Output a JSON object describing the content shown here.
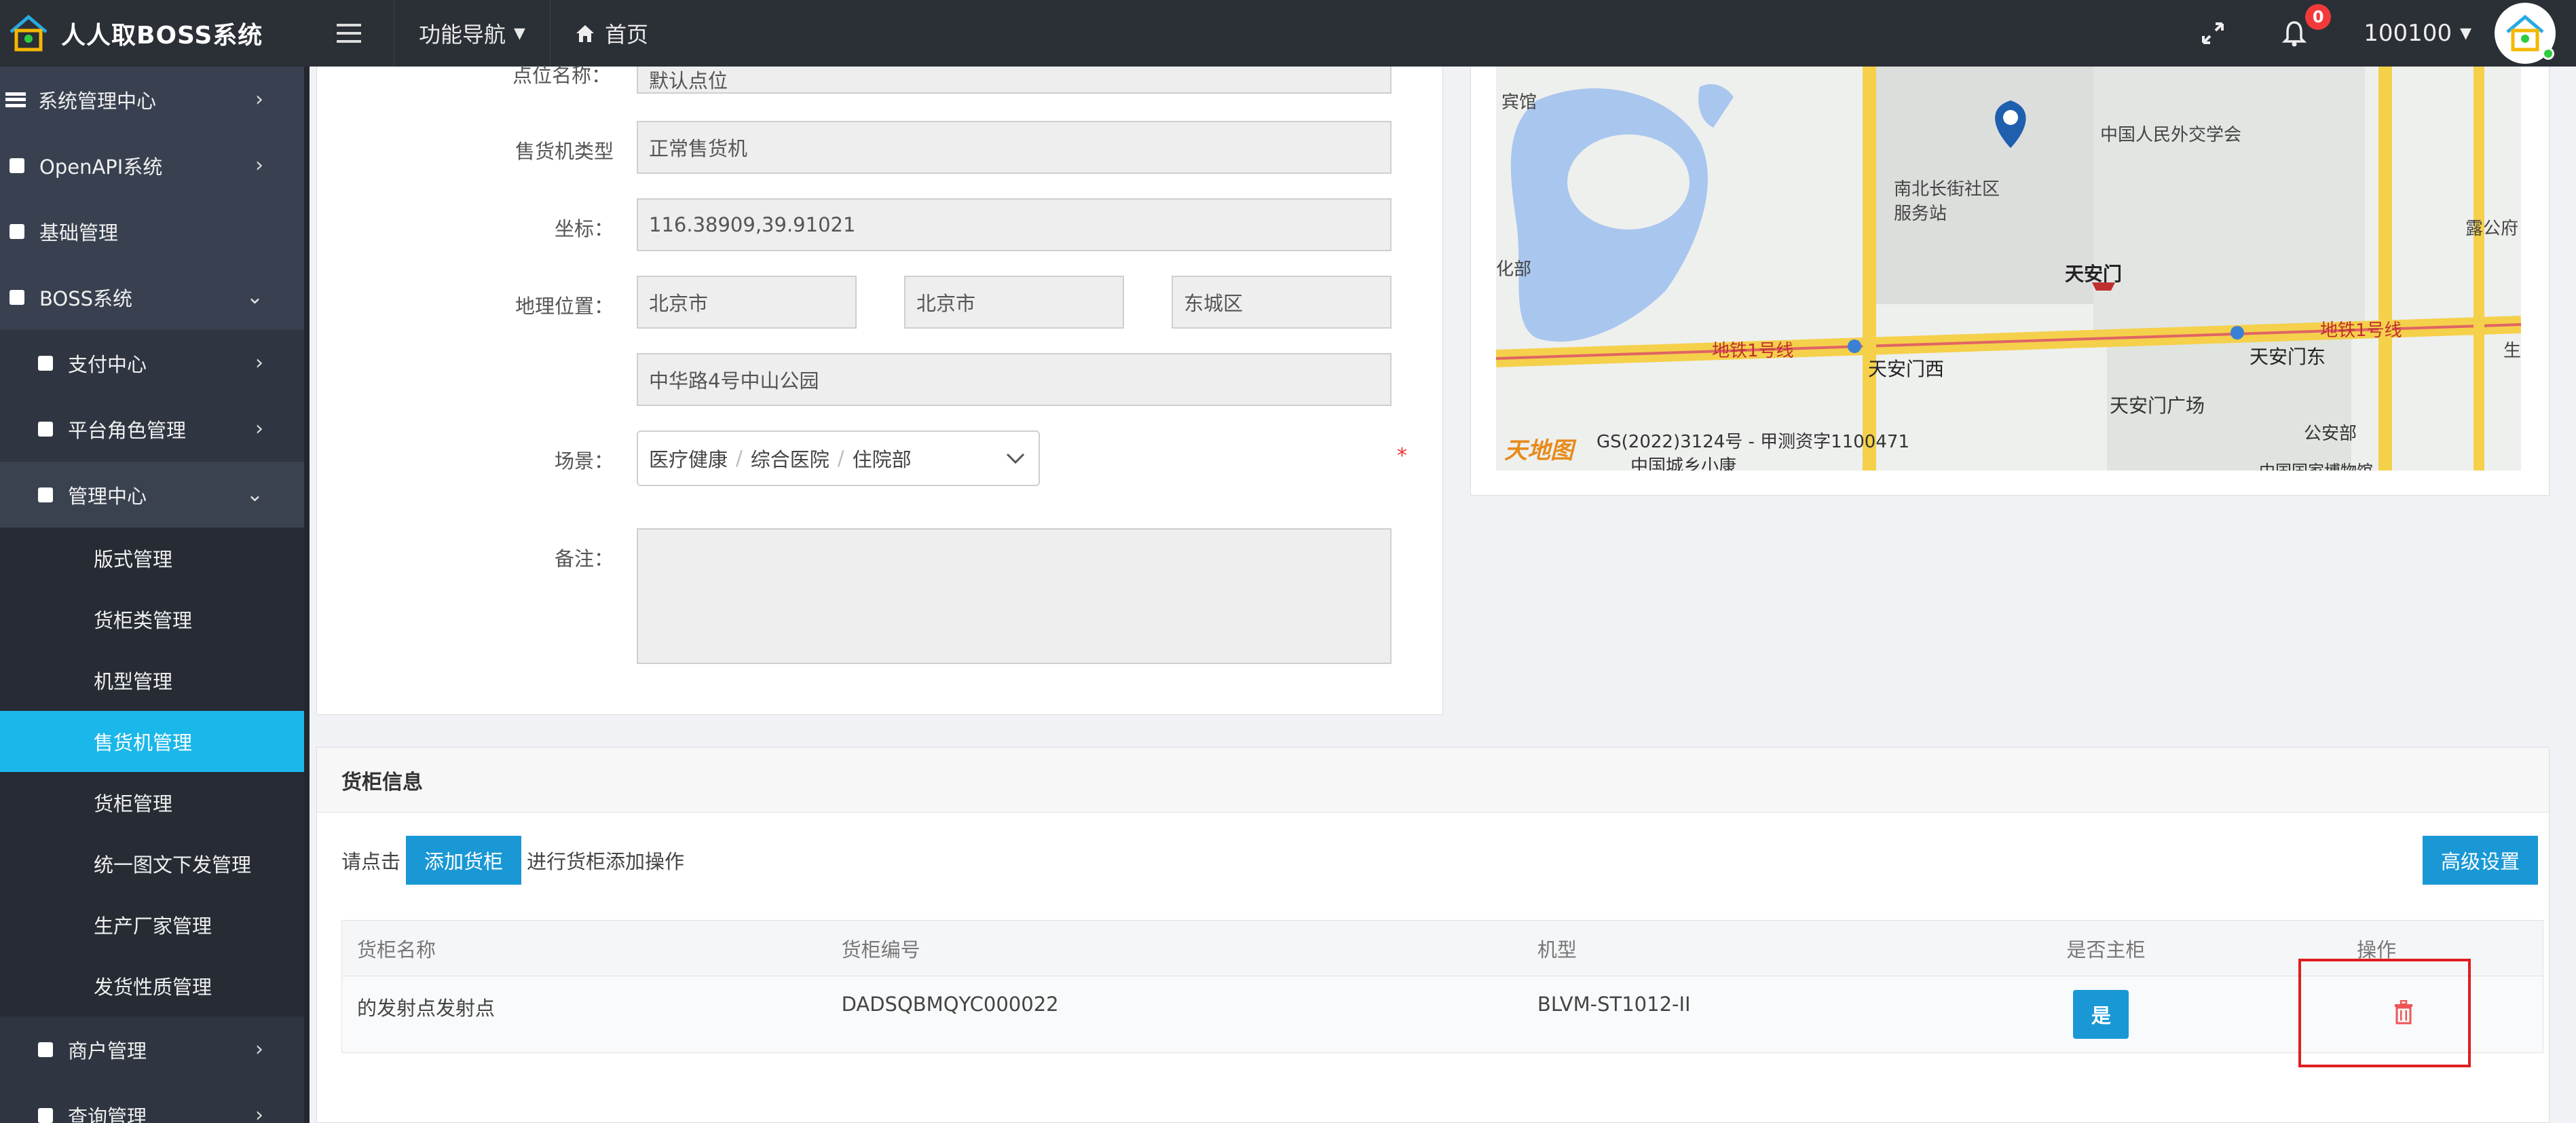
{
  "header": {
    "brand_title": "人人取BOSS系统",
    "nav_function": "功能导航",
    "nav_home": "首页",
    "notification_count": "0",
    "user_id": "100100"
  },
  "sidebar": {
    "items": [
      {
        "label": "系统管理中心"
      },
      {
        "label": "OpenAPI系统"
      },
      {
        "label": "基础管理"
      },
      {
        "label": "BOSS系统"
      },
      {
        "label": "支付中心"
      },
      {
        "label": "平台角色管理"
      },
      {
        "label": "管理中心"
      },
      {
        "label": "版式管理"
      },
      {
        "label": "货柜类管理"
      },
      {
        "label": "机型管理"
      },
      {
        "label": "售货机管理"
      },
      {
        "label": "货柜管理"
      },
      {
        "label": "统一图文下发管理"
      },
      {
        "label": "生产厂家管理"
      },
      {
        "label": "发货性质管理"
      },
      {
        "label": "商户管理"
      },
      {
        "label": "查询管理"
      }
    ]
  },
  "form": {
    "point_name_label": "点位名称：",
    "point_name_value": "默认点位",
    "machine_type_label": "售货机类型",
    "machine_type_value": "正常售货机",
    "coord_label": "坐标：",
    "coord_value": "116.38909,39.91021",
    "location_label": "地理位置：",
    "province": "北京市",
    "city": "北京市",
    "district": "东城区",
    "address": "中华路4号中山公园",
    "scene_label": "场景：",
    "scene_1": "医疗健康",
    "scene_2": "综合医院",
    "scene_3": "住院部",
    "required_mark": "*",
    "remark_label": "备注："
  },
  "map": {
    "labels": {
      "hotel": "宾馆",
      "diplomacy": "中国人民外交学会",
      "service": "南北长街社区",
      "service2": "服务站",
      "lugong": "露公府",
      "culture": "化部",
      "tiananmen": "天安门",
      "line1_left": "地铁1号线",
      "line1_right": "地铁1号线",
      "west": "天安门西",
      "east": "天安门东",
      "square": "天安门广场",
      "police": "公安部",
      "gs": "GS(2022)3124号 - 甲测资字1100471",
      "village": "中国城乡小康",
      "museum": "中国国家博物馆",
      "brand": "天地图",
      "edge": "生"
    }
  },
  "cabinet": {
    "section_title": "货柜信息",
    "hint_prefix": "请点击",
    "add_button": "添加货柜",
    "hint_suffix": "进行货柜添加操作",
    "advanced_button": "高级设置",
    "columns": [
      "货柜名称",
      "货柜编号",
      "机型",
      "是否主柜",
      "操作"
    ],
    "rows": [
      {
        "name": "的发射点发射点",
        "code": "DADSQBMQYC000022",
        "model": "BLVM-ST1012-II",
        "is_main": "是"
      }
    ]
  }
}
